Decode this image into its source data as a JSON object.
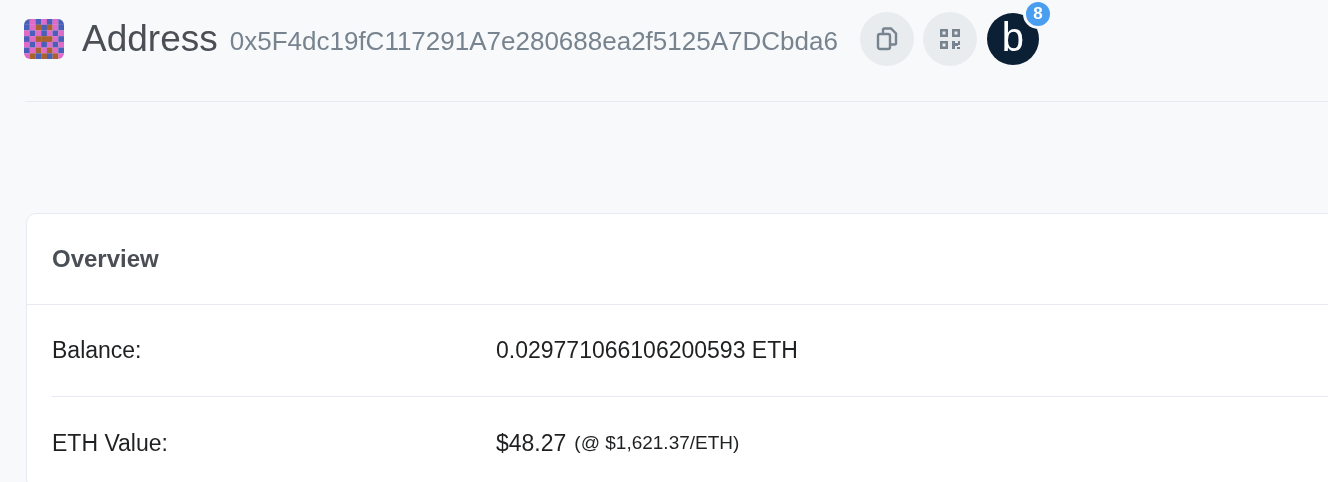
{
  "header": {
    "title": "Address",
    "address": "0x5F4dc19fC117291A7e280688ea2f5125A7DCbda6",
    "chat_button": {
      "label": "b",
      "badge": "8"
    }
  },
  "overview": {
    "title": "Overview",
    "rows": [
      {
        "label": "Balance:",
        "value": "0.029771066106200593 ETH"
      },
      {
        "label": "ETH Value:",
        "value": "$48.27",
        "note": "(@ $1,621.37/ETH)"
      }
    ]
  }
}
